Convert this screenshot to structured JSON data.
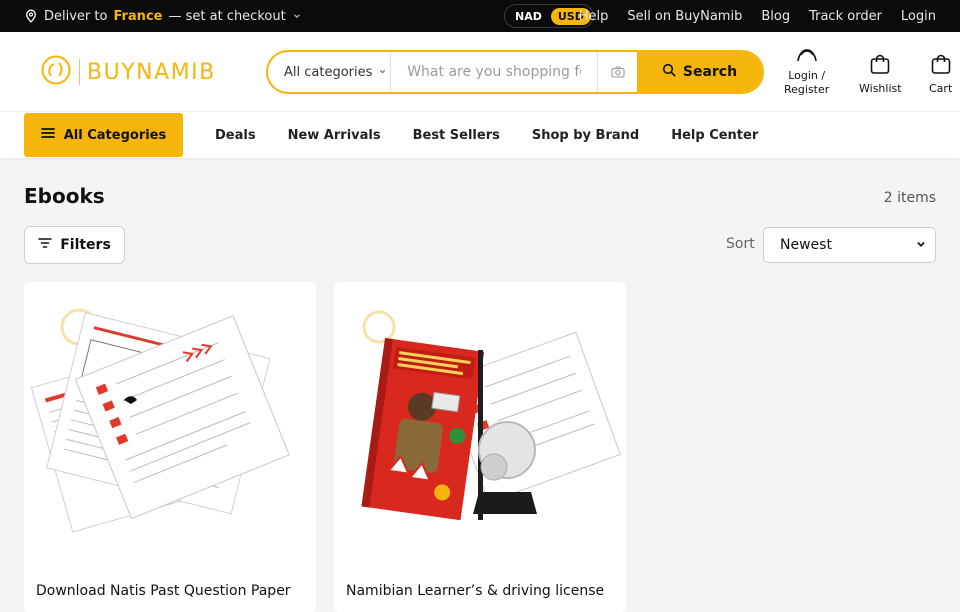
{
  "topbar": {
    "deliver_prefix": "Deliver to",
    "deliver_country": "France",
    "deliver_suffix": "— set at checkout",
    "currencies": [
      "NAD",
      "USD"
    ],
    "active_currency": "USD",
    "links": [
      "Help",
      "Sell on BuyNamib",
      "Blog",
      "Track order",
      "Login"
    ]
  },
  "header": {
    "logo_text": "BUYNAMIB",
    "category_select": "All categories",
    "search_placeholder": "What are you shopping for?",
    "search_button": "Search",
    "account_line1": "Login /",
    "account_line2": "Register",
    "wishlist": "Wishlist",
    "cart": "Cart"
  },
  "nav": {
    "all_categories": "All Categories",
    "links": [
      "Deals",
      "New Arrivals",
      "Best Sellers",
      "Shop by Brand",
      "Help Center"
    ]
  },
  "listing": {
    "title": "Ebooks",
    "count": "2 items",
    "filters_label": "Filters",
    "sort_label": "Sort",
    "sort_value": "Newest"
  },
  "products": [
    {
      "name": "Download Natis Past Question Paper"
    },
    {
      "name": "Namibian Learner’s & driving license"
    }
  ],
  "colors": {
    "accent": "#f5b50a",
    "topbar": "#0b0b0d"
  },
  "icons": [
    "location-pin-icon",
    "chevron-down-icon",
    "camera-icon",
    "search-icon",
    "user-icon",
    "bag-icon",
    "menu-icon",
    "filter-icon"
  ]
}
